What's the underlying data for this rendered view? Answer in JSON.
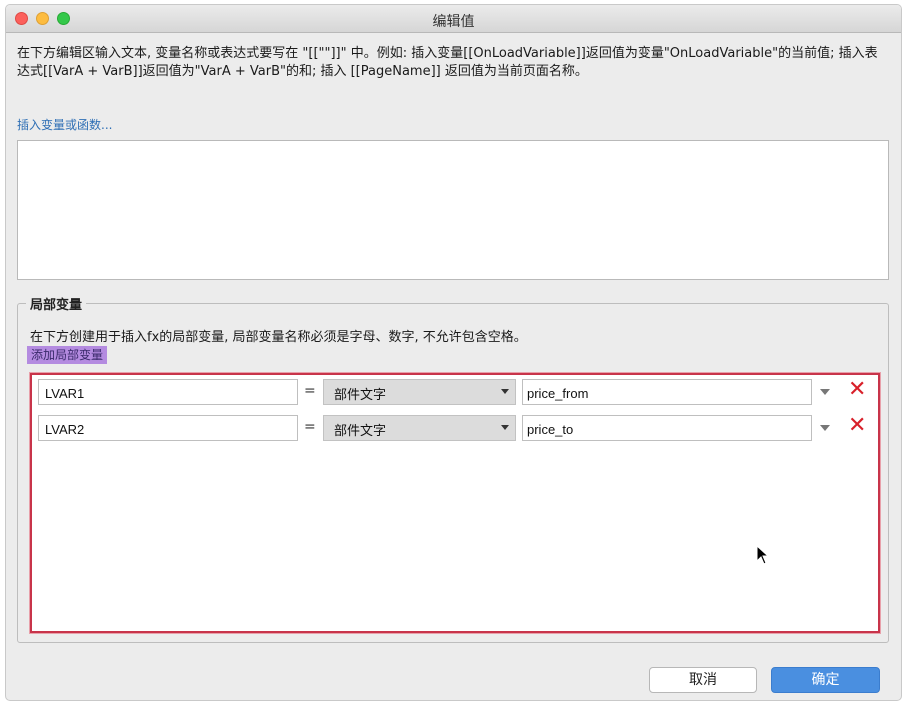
{
  "window": {
    "title": "编辑值"
  },
  "instructions": {
    "text": "在下方编辑区输入文本, 变量名称或表达式要写在 \"[[\"\"]]\" 中。例如: 插入变量[[OnLoadVariable]]返回值为变量\"OnLoadVariable\"的当前值; 插入表达式[[VarA + VarB]]返回值为\"VarA + VarB\"的和; 插入 [[PageName]] 返回值为当前页面名称。"
  },
  "insert_link": "插入变量或函数...",
  "editor": {
    "value": ""
  },
  "local_vars": {
    "legend": "局部变量",
    "description": "在下方创建用于插入fx的局部变量, 局部变量名称必须是字母、数字, 不允许包含空格。",
    "add_label": "添加局部变量",
    "rows": [
      {
        "name": "LVAR1",
        "equals": "=",
        "type": "部件文字",
        "value": "price_from"
      },
      {
        "name": "LVAR2",
        "equals": "=",
        "type": "部件文字",
        "value": "price_to"
      }
    ],
    "delete_symbol": "✕"
  },
  "buttons": {
    "cancel": "取消",
    "ok": "确定"
  },
  "colors": {
    "accent": "#4a8fe0",
    "highlight": "#b48be0",
    "panel_border": "#c8344a",
    "delete": "#d8202a",
    "link": "#2f6fb5"
  },
  "icons": {
    "dropdown": "chevron-down-icon",
    "delete": "close-icon",
    "cursor": "mouse-pointer-icon"
  }
}
